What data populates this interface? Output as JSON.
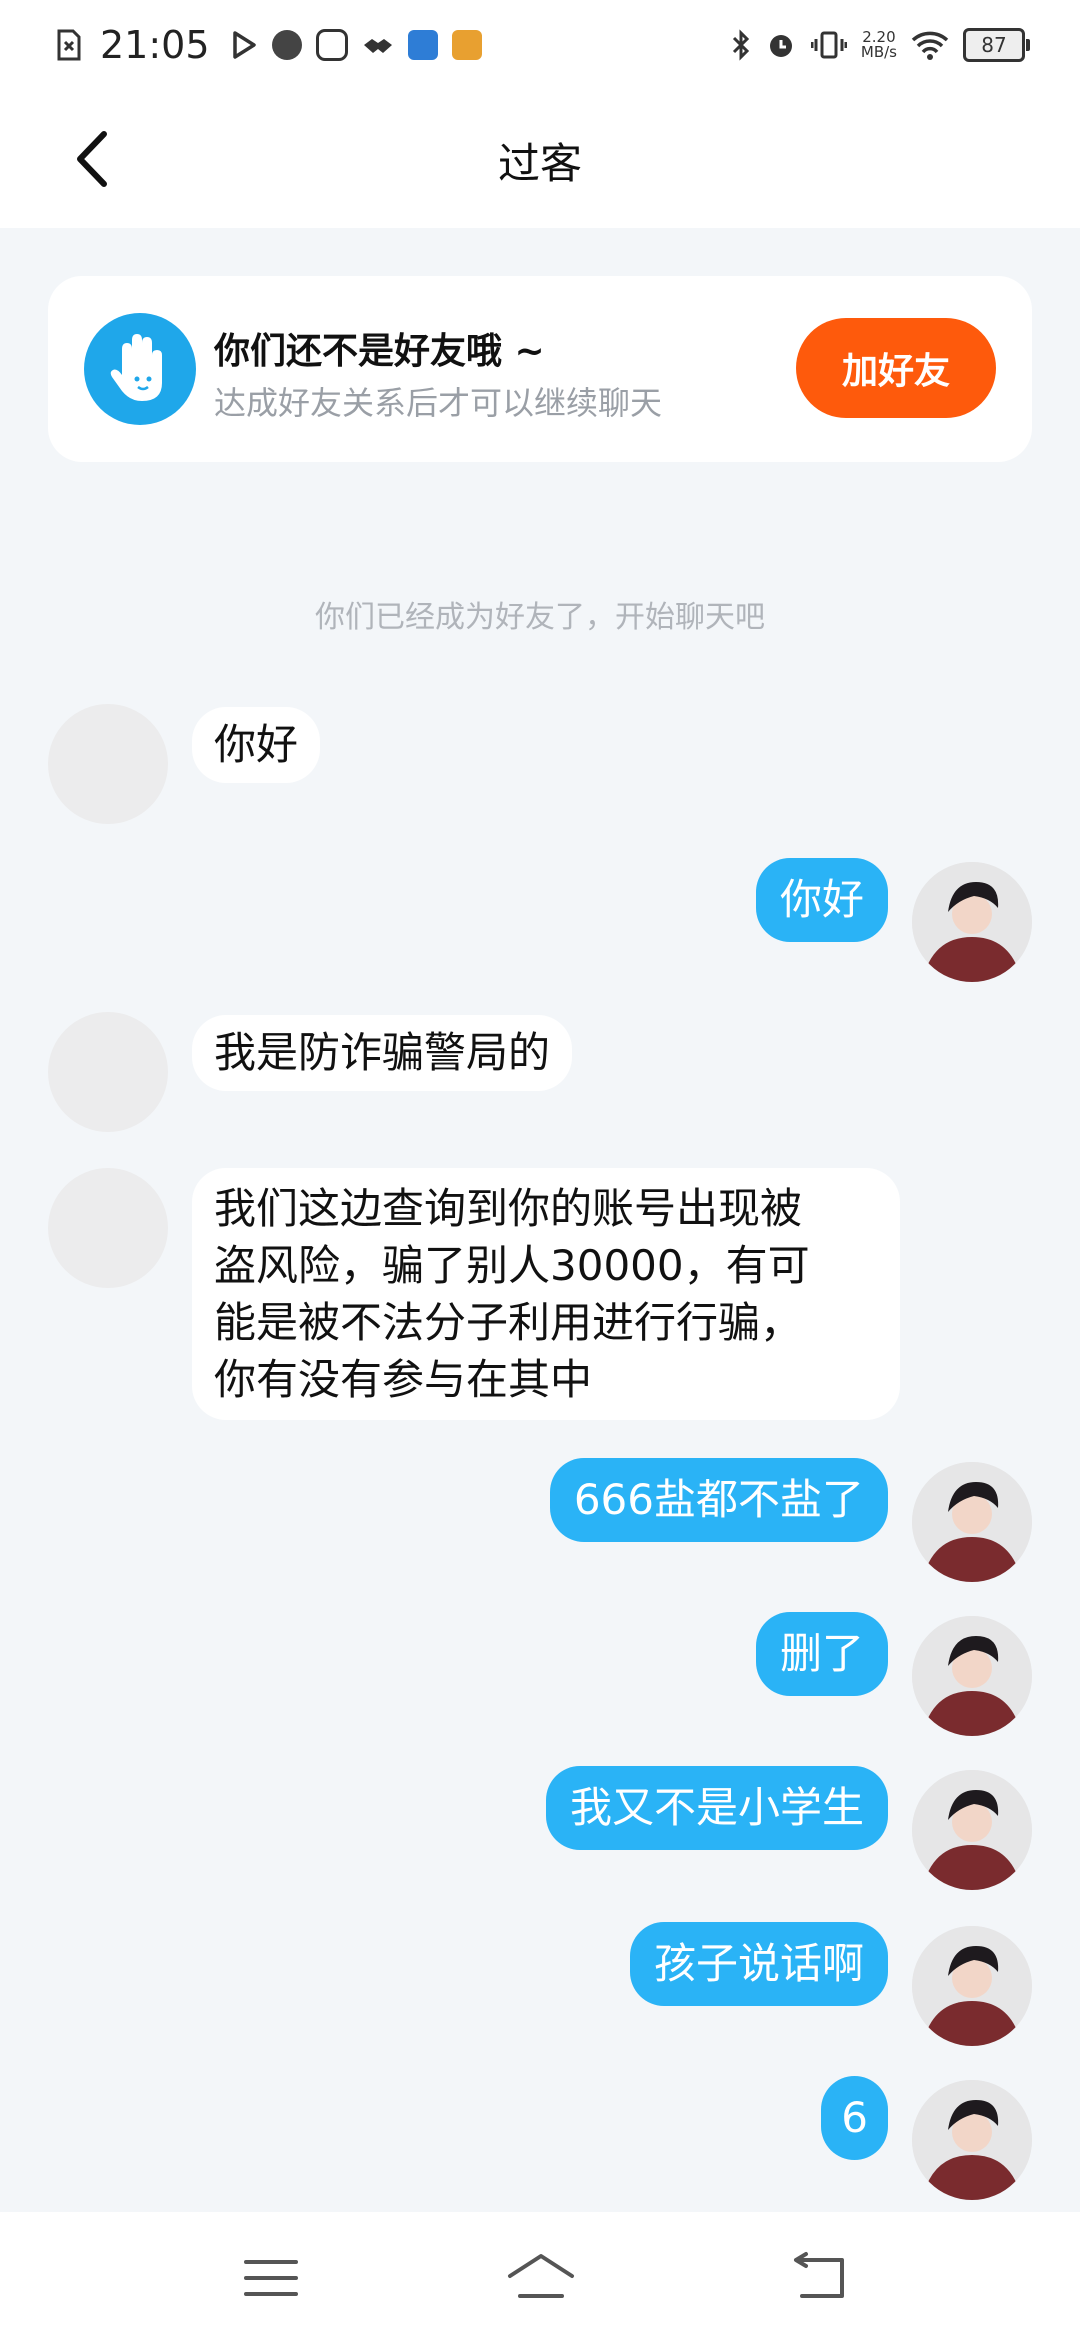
{
  "status_bar": {
    "time": "21:05",
    "net_speed_value": "2.20",
    "net_speed_unit": "MB/s",
    "battery": "87",
    "icons": [
      "sim-icon",
      "play-icon",
      "app-icon",
      "qq-icon",
      "handshake-icon",
      "app-icon",
      "app-icon",
      "bluetooth-icon",
      "alarm-icon",
      "vibrate-icon",
      "wifi-icon",
      "battery-icon"
    ]
  },
  "header": {
    "title": "过客"
  },
  "friend_card": {
    "title": "你们还不是好友哦 ~",
    "subtitle": "达成好友关系后才可以继续聊天",
    "button": "加好友",
    "accent": "#fe5a0c",
    "icon": "hand-wave-icon"
  },
  "system_note": "你们已经成为好友了，开始聊天吧",
  "messages": [
    {
      "side": "in",
      "text": "你好"
    },
    {
      "side": "out",
      "text": "你好"
    },
    {
      "side": "in",
      "text": "我是防诈骗警局的"
    },
    {
      "side": "in",
      "lines": [
        "我们这边查询到你的账号出现被",
        "盗风险，骗了别人30000，有可",
        "能是被不法分子利用进行行骗，",
        "你有没有参与在其中"
      ]
    },
    {
      "side": "out",
      "text": "666盐都不盐了"
    },
    {
      "side": "out",
      "text": "删了"
    },
    {
      "side": "out",
      "text": "我又不是小学生"
    },
    {
      "side": "out",
      "text": "孩子说话啊"
    },
    {
      "side": "out",
      "text": "6"
    }
  ],
  "colors": {
    "outgoing_bubble": "#2ab3f6",
    "background": "#f3f6f9"
  },
  "nav": [
    "menu-icon",
    "home-icon",
    "back-icon"
  ]
}
